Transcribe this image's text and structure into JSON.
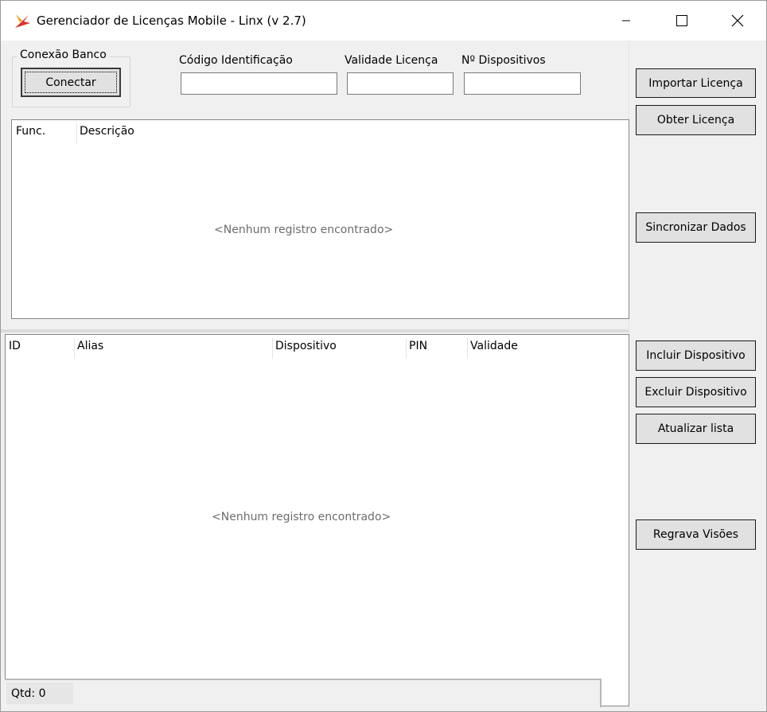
{
  "window": {
    "title": "Gerenciador de Licenças Mobile - Linx (v 2.7)",
    "icon": "linx-logo-icon",
    "controls": [
      "minimize-icon",
      "maximize-icon",
      "close-icon"
    ]
  },
  "connection": {
    "group_title": "Conexão Banco",
    "connect_label": "Conectar"
  },
  "license_fields": {
    "codigo_label": "Código Identificação",
    "codigo_value": "",
    "validade_label": "Validade Licença",
    "validade_value": "",
    "dispositivos_label": "Nº Dispositivos",
    "dispositivos_value": ""
  },
  "actions_top": {
    "import_label": "Importar Licença",
    "obtain_label": "Obter Licença",
    "sync_label": "Sincronizar Dados"
  },
  "functions_grid": {
    "columns": [
      "Func.",
      "Descrição"
    ],
    "rows": [],
    "empty_text": "<Nenhum registro encontrado>"
  },
  "devices_grid": {
    "columns": [
      "ID",
      "Alias",
      "Dispositivo",
      "PIN",
      "Validade"
    ],
    "rows": [],
    "empty_text": "<Nenhum registro encontrado>"
  },
  "actions_bottom": {
    "include_label": "Incluir Dispositivo",
    "exclude_label": "Excluir Dispositivo",
    "refresh_label": "Atualizar lista",
    "rewrite_label": "Regrava Visões"
  },
  "status": {
    "qtd_text": "Qtd: 0"
  },
  "colors": {
    "window_bg": "#f0f0f0",
    "button_bg": "#e1e1e1",
    "logo_red": "#d9352a",
    "logo_orange": "#f29a1d"
  }
}
